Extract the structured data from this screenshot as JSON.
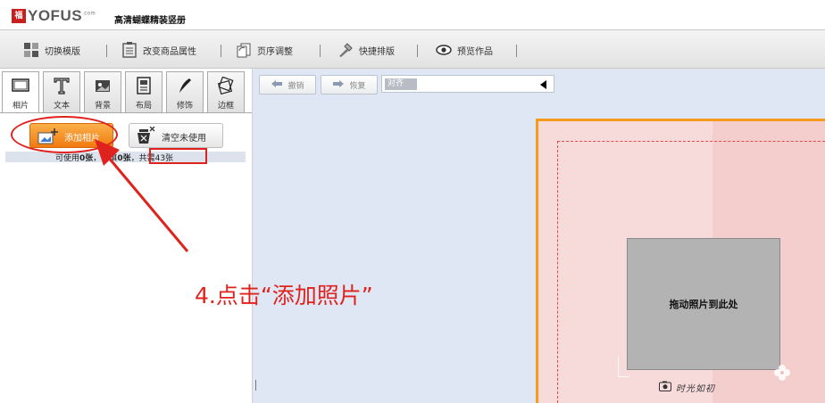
{
  "brand": {
    "logo_mark": "福",
    "logo_text": "YOFUS",
    "logo_sup": ".com",
    "app_title": "高清蝴蝶精装竖册"
  },
  "toolbar": {
    "items": [
      {
        "label": "切换模版",
        "icon": "template-icon"
      },
      {
        "label": "改变商品属性",
        "icon": "properties-icon"
      },
      {
        "label": "页序调整",
        "icon": "page-order-icon"
      },
      {
        "label": "快捷排版",
        "icon": "quick-layout-icon"
      },
      {
        "label": "预览作品",
        "icon": "eye-icon"
      }
    ]
  },
  "left_tabs": [
    {
      "label": "相片",
      "icon": "photo-frame-icon"
    },
    {
      "label": "文本",
      "icon": "text-icon"
    },
    {
      "label": "背景",
      "icon": "background-icon"
    },
    {
      "label": "布局",
      "icon": "layout-icon"
    },
    {
      "label": "修饰",
      "icon": "decoration-icon"
    },
    {
      "label": "边框",
      "icon": "border-icon"
    }
  ],
  "photo_panel": {
    "add_button": "添加相片",
    "clear_button": "清空未使用",
    "count_text_a": "可使用",
    "count_available": "0张",
    "count_text_b": "已填",
    "count_filled": "0张",
    "count_sep": "，",
    "count_total": "共需43张"
  },
  "canvas_toolbar": {
    "undo": "撤销",
    "redo": "恢复",
    "align_label": "对齐"
  },
  "page": {
    "drop_hint": "拖动照片到此处",
    "caption": "时光如初"
  },
  "annotation": {
    "instruction": "4.点击“添加照片”",
    "color": "#e0221f"
  },
  "colors": {
    "accent_orange": "#f39a1f",
    "canvas_bg": "#dfe7f4",
    "page_pink": "#f4cdcd"
  }
}
